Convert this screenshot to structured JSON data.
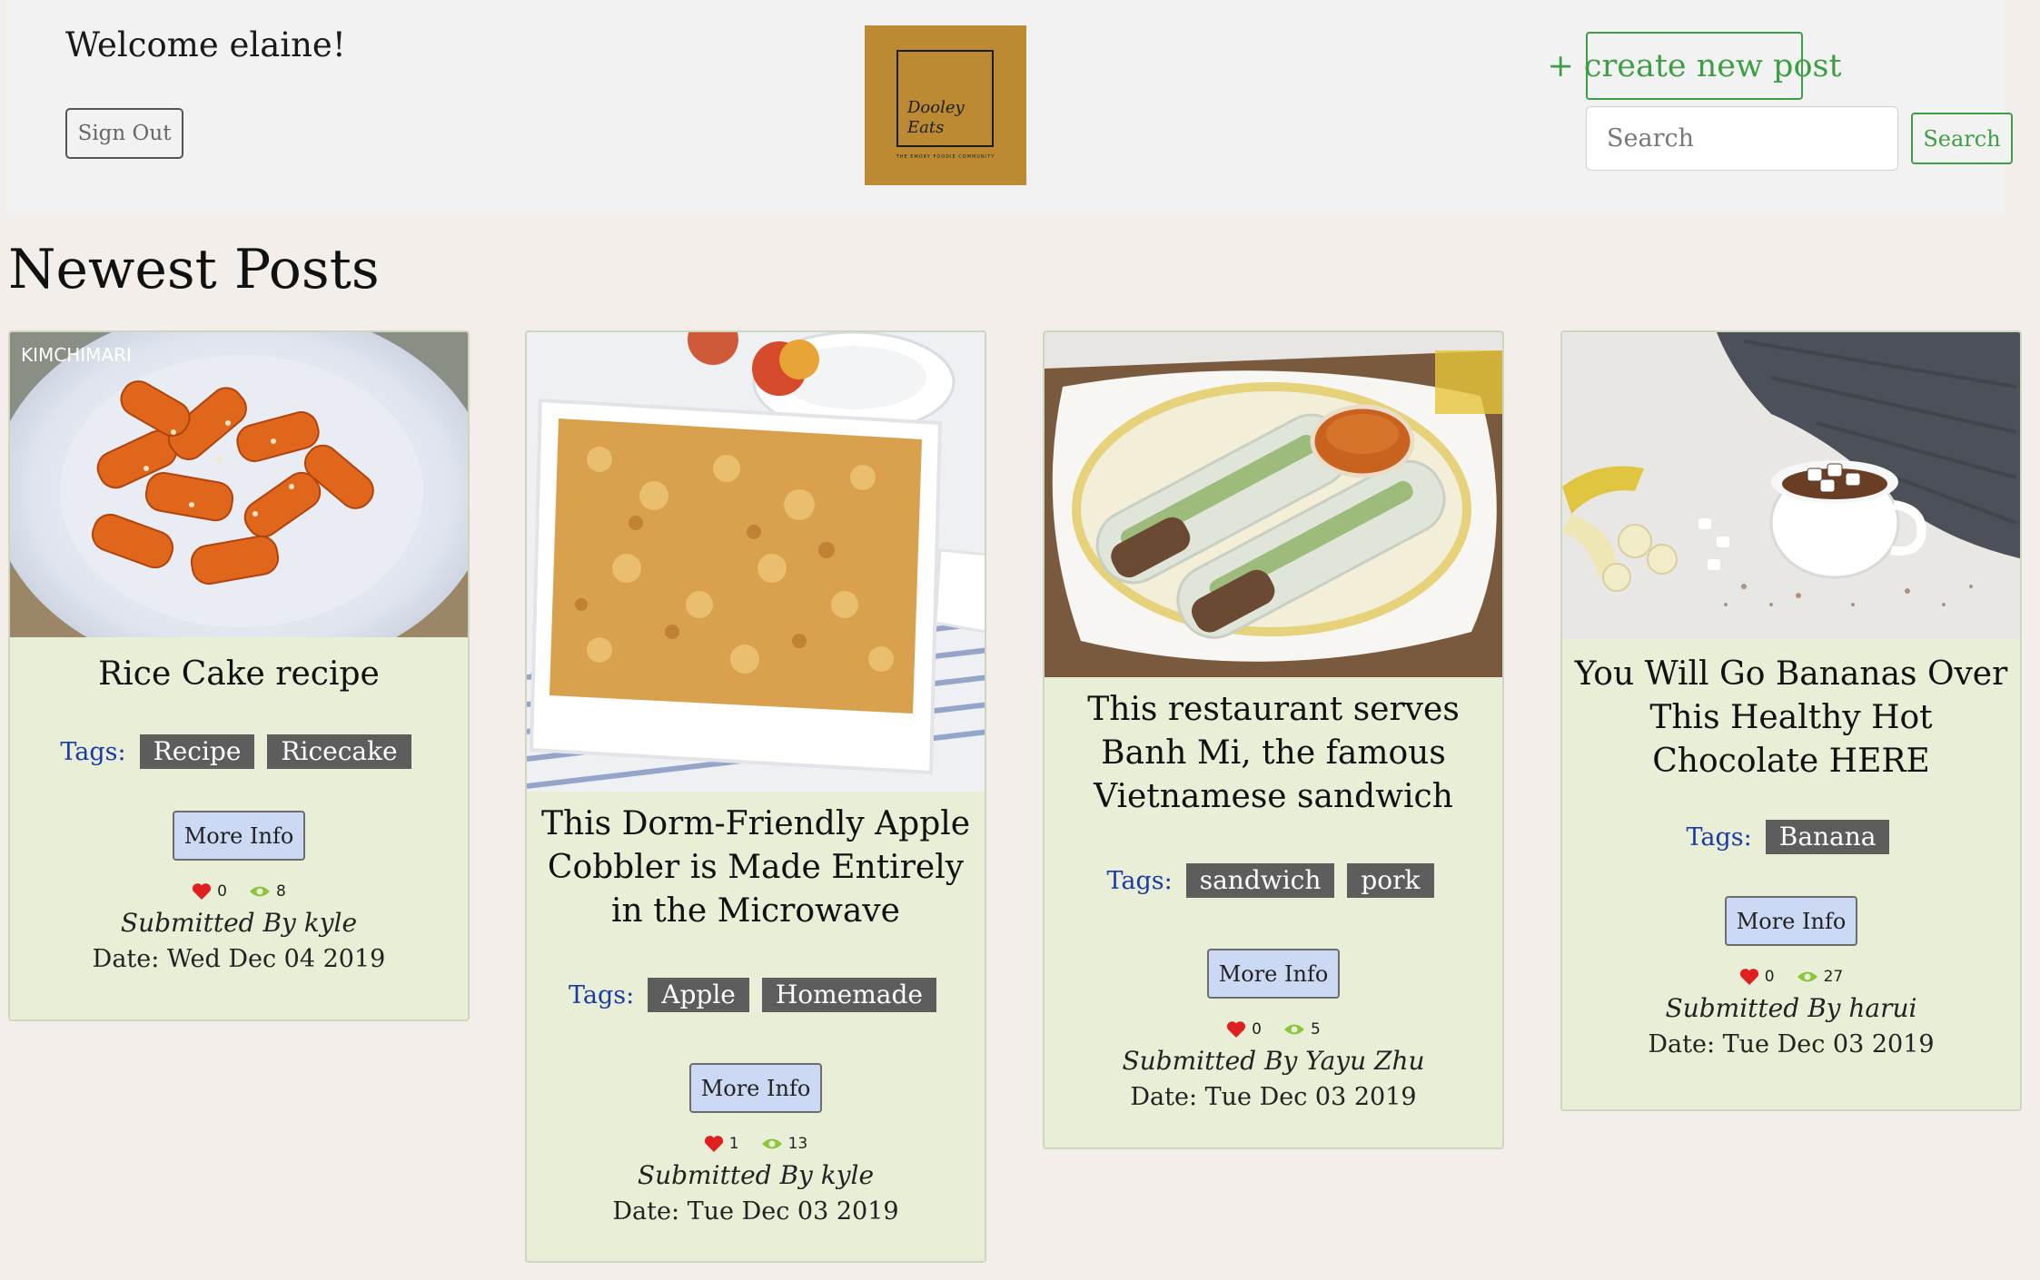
{
  "header": {
    "welcome": "Welcome elaine!",
    "sign_out_label": "Sign Out",
    "logo_line1": "Dooley",
    "logo_line2": "Eats",
    "logo_tagline": "THE EMORY FOODIE COMMUNITY",
    "create_post_label": "+ create new post",
    "search_placeholder": "Search",
    "search_button_label": "Search"
  },
  "section_title": "Newest Posts",
  "tags_label": "Tags:",
  "more_info_label": "More Info",
  "posts": [
    {
      "title": "Rice Cake recipe",
      "image_caption": "KIMCHIMARI",
      "tags": [
        "Recipe",
        "Ricecake"
      ],
      "likes": "0",
      "views": "8",
      "submitted_by": "Submitted By kyle",
      "date": "Date: Wed Dec 04 2019"
    },
    {
      "title": "This Dorm-Friendly Apple Cobbler is Made Entirely in the Microwave",
      "tags": [
        "Apple",
        "Homemade"
      ],
      "likes": "1",
      "views": "13",
      "submitted_by": "Submitted By kyle",
      "date": "Date: Tue Dec 03 2019"
    },
    {
      "title": "This restaurant serves Banh Mi, the famous Vietnamese sandwich",
      "tags": [
        "sandwich",
        "pork"
      ],
      "likes": "0",
      "views": "5",
      "submitted_by": "Submitted By Yayu Zhu",
      "date": "Date: Tue Dec 03 2019"
    },
    {
      "title": "You Will Go Bananas Over This Healthy Hot Chocolate HERE",
      "tags": [
        "Banana"
      ],
      "likes": "0",
      "views": "27",
      "submitted_by": "Submitted By harui",
      "date": "Date: Tue Dec 03 2019"
    }
  ],
  "colors": {
    "page_bg": "#f3eee9",
    "header_bg": "#f2f2f2",
    "card_bg": "#e8efd6",
    "green_accent": "#3f9e45",
    "tag_bg": "#5d5d5d",
    "tags_label": "#1a3aa8",
    "more_info_bg": "#ccd9f4",
    "logo_bg": "#bb8a33",
    "heart": "#e02020",
    "eye": "#8cc43c"
  },
  "icons": {
    "like": "heart-icon",
    "views": "eye-icon"
  }
}
